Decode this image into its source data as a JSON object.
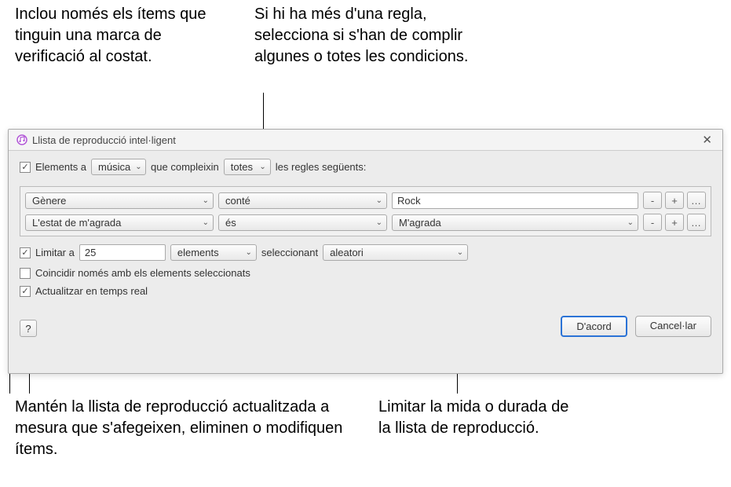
{
  "callouts": {
    "top_left": "Inclou només els ítems que tinguin una marca de verificació al costat.",
    "top_right": "Si hi ha més d'una regla, selecciona si s'han de complir algunes o totes les condicions.",
    "bottom_left": "Mantén la llista de reproducció actualitzada a mesura que s'afegeixen, eliminen o modifiquen ítems.",
    "bottom_right": "Limitar la mida o durada de la llista de reproducció."
  },
  "dialog": {
    "title": "Llista de reproducció intel·ligent",
    "match": {
      "label_prefix": "Elements a",
      "source": "música",
      "label_mid": "que compleixin",
      "scope": "totes",
      "label_suffix": "les regles següents:",
      "checked": true
    },
    "rules": [
      {
        "attribute": "Gènere",
        "operator": "conté",
        "value": "Rock",
        "value_type": "text"
      },
      {
        "attribute": "L'estat de m'agrada",
        "operator": "és",
        "value": "M'agrada",
        "value_type": "select"
      }
    ],
    "rule_buttons": {
      "remove": "-",
      "add": "+",
      "more": "…"
    },
    "limit": {
      "checked": true,
      "label": "Limitar a",
      "value": "25",
      "unit": "elements",
      "select_label": "seleccionant",
      "selection": "aleatori"
    },
    "match_checked_only": {
      "checked": false,
      "label": "Coincidir només amb els elements seleccionats"
    },
    "live_update": {
      "checked": true,
      "label": "Actualitzar en temps real"
    },
    "help": "?",
    "ok": "D'acord",
    "cancel": "Cancel·lar"
  }
}
